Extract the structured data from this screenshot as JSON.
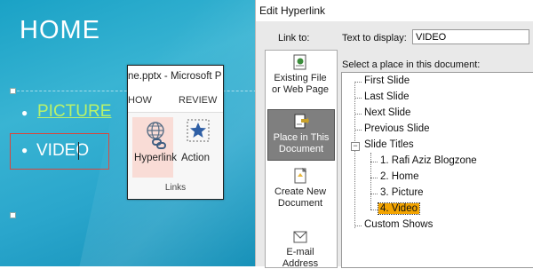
{
  "slide": {
    "title": "HOME",
    "bullets": [
      "PICTURE",
      "VIDEO"
    ]
  },
  "ribbon": {
    "title": "ne.pptx - Microsoft P",
    "tabs": [
      "HOW",
      "REVIEW"
    ],
    "hyperlink_label": "Hyperlink",
    "action_label": "Action",
    "group_label": "Links"
  },
  "dialog": {
    "title": "Edit Hyperlink",
    "link_to_label": "Link to:",
    "nav": [
      {
        "line1": "Existing File",
        "line2": "or Web Page",
        "selected": false
      },
      {
        "line1": "Place in This",
        "line2": "Document",
        "selected": true
      },
      {
        "line1": "Create New",
        "line2": "Document",
        "selected": false
      },
      {
        "line1": "E-mail",
        "line2": "Address",
        "selected": false
      }
    ],
    "text_to_display_label": "Text to display:",
    "text_to_display_value": "VIDEO",
    "place_label": "Select a place in this document:",
    "tree": {
      "first_slide": "First Slide",
      "last_slide": "Last Slide",
      "next_slide": "Next Slide",
      "previous_slide": "Previous Slide",
      "slide_titles": "Slide Titles",
      "expander": "−",
      "children": [
        "1. Rafi Aziz Blogzone",
        "2. Home",
        "3. Picture",
        "4. Video"
      ],
      "selected": "4. Video",
      "custom_shows": "Custom Shows"
    }
  },
  "colors": {
    "slide_bg": "#2aa6cc",
    "link_green": "#b9f26a",
    "selection_orange": "#f3a400",
    "nav_selected": "#7f7f7f",
    "video_box_border": "#d9453a"
  }
}
